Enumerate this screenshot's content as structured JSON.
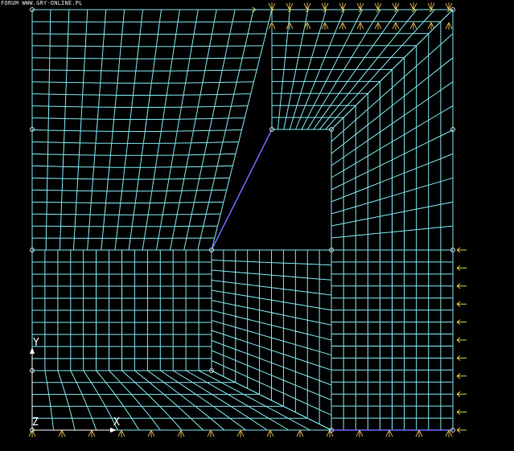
{
  "watermark": "FORUM WWW.GRY-ONLINE.PL",
  "axes": {
    "y_label": "Y",
    "x_label": "X",
    "z_label": "Z"
  },
  "colors": {
    "background": "#000000",
    "mesh": "#7fe8f0",
    "boundary_node": "#d7d7d7",
    "support": "#c9a64a",
    "load_arrow": "#d8d24a",
    "edge_highlight": "#6a6aff",
    "axis": "#ffffff"
  },
  "icons": [
    "support-icon",
    "load-arrow-icon",
    "node-icon"
  ]
}
